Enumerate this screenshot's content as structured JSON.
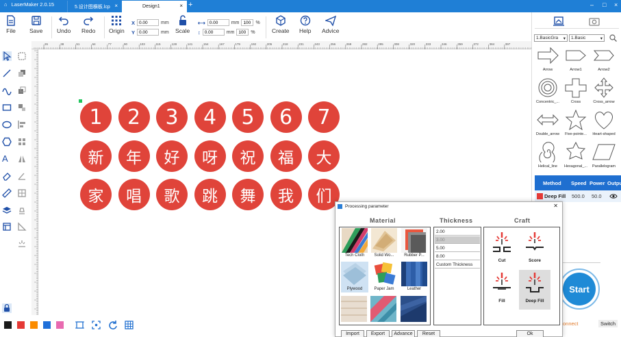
{
  "titlebar": {
    "app_title": "LaserMaker 2.0.15",
    "tabs": [
      {
        "label": "5.设计图横板.lcp",
        "active": false
      },
      {
        "label": "Design1",
        "active": true
      }
    ]
  },
  "toolbar": {
    "file": "File",
    "save": "Save",
    "undo": "Undo",
    "redo": "Redo",
    "origin": "Origin",
    "scale": "Scale",
    "create": "Create",
    "help": "Help",
    "advice": "Advice",
    "x_label": "X",
    "y_label": "Y",
    "x_value": "0.00",
    "y_value": "0.00",
    "unit": "mm",
    "w_value": "0.00",
    "h_value": "0.00",
    "w_percent": "100",
    "h_percent": "100",
    "percent_sign": "%"
  },
  "ruler_ticks": [
    "26",
    "38",
    "51",
    "64",
    "77",
    "90",
    "103",
    "115",
    "128",
    "141",
    "154",
    "167",
    "179",
    "192",
    "205",
    "218",
    "231",
    "243",
    "256",
    "269",
    "282",
    "295",
    "308",
    "320",
    "333",
    "346",
    "359",
    "372",
    "384",
    "397"
  ],
  "canvas": {
    "row1": [
      "1",
      "2",
      "3",
      "4",
      "5",
      "6",
      "7"
    ],
    "row2": [
      "新",
      "年",
      "好",
      "呀",
      "祝",
      "福",
      "大"
    ],
    "row3": [
      "家",
      "唱",
      "歌",
      "跳",
      "舞",
      "我",
      "们"
    ]
  },
  "right_panel": {
    "library_select": "1.BasicGra",
    "category_select": "1.Basic",
    "shapes": [
      "Arrow",
      "Arrow1",
      "Arrow2",
      "Concentric_...",
      "Cross",
      "Cross_arrow",
      "Double_arrow",
      "Five-pointe...",
      "Heart-shaped",
      "Helical_line",
      "Hexagonal_...",
      "Parallelogram"
    ],
    "layer_headers": {
      "method": "Method",
      "speed": "Speed",
      "power": "Power",
      "output": "Output"
    },
    "layer_row": {
      "method": "Deep Fill",
      "speed": "500.0",
      "power": "50.0",
      "color": "#e53935"
    },
    "start": "Start",
    "connect": "onnect",
    "switch": "Switch"
  },
  "dialog": {
    "title": "Processing parameter",
    "material_header": "Material",
    "thickness_header": "Thickness",
    "craft_header": "Craft",
    "materials": [
      "Tech Cloth",
      "Solid Wo...",
      "Rubber P...",
      "Plywood",
      "Paper Jam",
      "Leather"
    ],
    "thickness": [
      "2.00",
      "3.00",
      "5.00",
      "8.00",
      "Custom Thickness"
    ],
    "crafts": [
      "Cut",
      "Score",
      "Fill",
      "Deep Fill"
    ],
    "buttons": {
      "import": "Import",
      "export": "Export",
      "advance": "Advance",
      "reset": "Reset",
      "ok": "Ok"
    }
  },
  "palette_colors": [
    "#1a1a1a",
    "#e53935",
    "#fb8c00",
    "#1e6fd9",
    "#e86ab0"
  ],
  "accent_color": "#1f7fd6"
}
